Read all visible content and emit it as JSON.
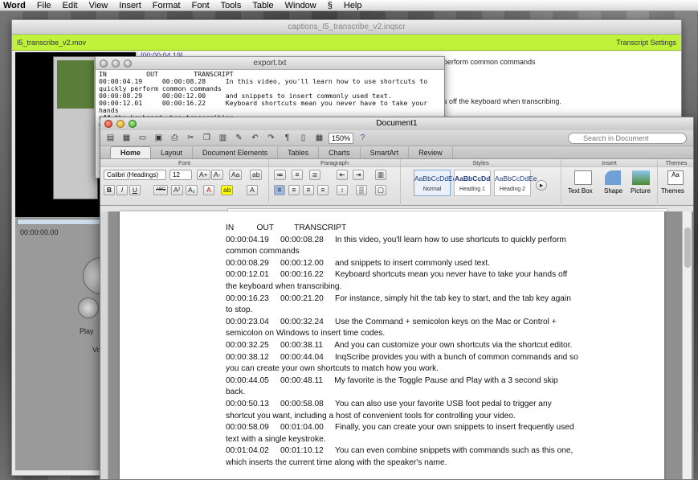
{
  "menubar": {
    "app": "Word",
    "items": [
      "File",
      "Edit",
      "View",
      "Insert",
      "Format",
      "Font",
      "Tools",
      "Table",
      "Window",
      "Help"
    ]
  },
  "inqscribe": {
    "title": "captions_I5_transcribe_v2.inqscr",
    "media": "I5_transcribe_v2.mov",
    "settings": "Transcript Settings",
    "timecode": "[00:00:04.19]",
    "snippet1": "perform common commands",
    "snippet2": "s off the keyboard when transcribing.",
    "time_display": "00:00:00.00",
    "play_label": "Play",
    "vol_label": "Vo"
  },
  "export": {
    "title": "export.txt",
    "text": "IN          OUT         TRANSCRIPT\n00:00:04.19     00:00:08.28     In this video, you'll learn how to use shortcuts to\nquickly perform common commands\n00:00:08.29     00:00:12.00     and snippets to insert commonly used text.\n00:00:12.01     00:00:16.22     Keyboard shortcuts mean you never have to take your hands\noff the keyboard when transcribing.\n00:00:16.23     00:00:21.20     For instance, simply hit the tab key to start, and the tab"
  },
  "word": {
    "doc_title": "Document1",
    "zoom": "150%",
    "search_placeholder": "Search in Document",
    "tabs": [
      "Home",
      "Layout",
      "Document Elements",
      "Tables",
      "Charts",
      "SmartArt",
      "Review"
    ],
    "groups": {
      "font": "Font",
      "paragraph": "Paragraph",
      "styles": "Styles",
      "insert": "Insert",
      "themes": "Themes"
    },
    "font_name": "Calibri (Headings)",
    "font_size": "12",
    "styles": [
      {
        "sample": "AaBbCcDdEe",
        "name": "Normal"
      },
      {
        "sample": "AaBbCcDd",
        "name": "Heading 1"
      },
      {
        "sample": "AaBbCcDdEe",
        "name": "Heading 2"
      }
    ],
    "insert_items": [
      "Text Box",
      "Shape",
      "Picture"
    ],
    "themes_label": "Themes",
    "header": "IN          OUT         TRANSCRIPT",
    "rows": [
      {
        "in": "00:00:04.19",
        "out": "00:00:08.28",
        "text": "In this video, you'll learn how to use shortcuts to quickly perform common commands"
      },
      {
        "in": "00:00:08.29",
        "out": "00:00:12.00",
        "text": "and snippets to insert commonly used text."
      },
      {
        "in": "00:00:12.01",
        "out": "00:00:16.22",
        "text": "Keyboard shortcuts mean you never have to take your hands off the keyboard when transcribing."
      },
      {
        "in": "00:00:16.23",
        "out": "00:00:21.20",
        "text": "For instance, simply hit the tab key to start, and the tab key again to stop."
      },
      {
        "in": "00:00:23.04",
        "out": "00:00:32.24",
        "text": "Use the Command + semicolon keys on the Mac or Control + semicolon on Windows to insert time codes."
      },
      {
        "in": "00:00:32.25",
        "out": "00:00:38.11",
        "text": "And you can customize your own shortcuts via the shortcut editor."
      },
      {
        "in": "00:00:38.12",
        "out": "00:00:44.04",
        "text": "InqScribe provides you with a bunch of common commands and so you can create your own shortcuts to match how you work."
      },
      {
        "in": "00:00:44.05",
        "out": "00:00:48.11",
        "text": "My favorite is the Toggle Pause and Play with a 3 second skip back."
      },
      {
        "in": "00:00:50.13",
        "out": "00:00:58.08",
        "text": "You can also use your favorite USB foot pedal to trigger any shortcut you want, including a host of convenient tools for controlling your video."
      },
      {
        "in": "00:00:58.09",
        "out": "00:01:04.00",
        "text": "Finally, you can create your own snippets to insert frequently used text with a single keystroke."
      },
      {
        "in": "00:01:04.02",
        "out": "00:01:10.12",
        "text": "You can even combine snippets with commands such as this one, which inserts the current time along with the speaker's name."
      }
    ]
  }
}
